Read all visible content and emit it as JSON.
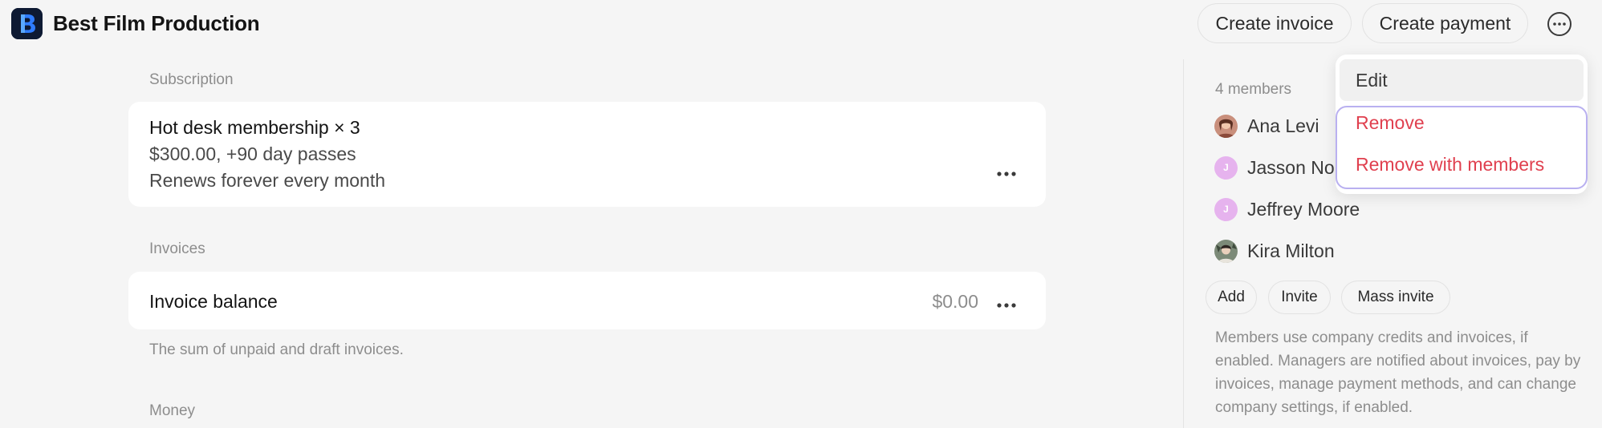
{
  "header": {
    "company_name": "Best Film Production",
    "logo_icon": "brand-b-logo",
    "create_invoice_label": "Create invoice",
    "create_payment_label": "Create payment",
    "more_icon": "more-circle-icon"
  },
  "subscription": {
    "section_label": "Subscription",
    "title": "Hot desk membership × 3",
    "price_line": "$300.00, +90 day passes",
    "renewal_line": "Renews forever every month"
  },
  "invoices": {
    "section_label": "Invoices",
    "balance_label": "Invoice balance",
    "balance_amount": "$0.00",
    "hint": "The sum of unpaid and draft invoices."
  },
  "money": {
    "section_label": "Money"
  },
  "members": {
    "count_label": "4 members",
    "list": [
      {
        "name": "Ana Levi",
        "avatar": "photo"
      },
      {
        "name": "Jasson No",
        "avatar": "initial",
        "initial": "J"
      },
      {
        "name": "Jeffrey Moore",
        "avatar": "initial",
        "initial": "J"
      },
      {
        "name": "Kira Milton",
        "avatar": "photo"
      }
    ],
    "add_label": "Add",
    "invite_label": "Invite",
    "mass_invite_label": "Mass invite",
    "description": "Members use company credits and invoices, if enabled. Managers are notified about invoices, pay by invoices, manage payment methods, and can change company settings, if enabled."
  },
  "dropdown": {
    "edit_label": "Edit",
    "remove_label": "Remove",
    "remove_with_members_label": "Remove with members"
  },
  "colors": {
    "background": "#f5f5f5",
    "danger": "#e0404f",
    "focus_ring": "#b9b0f0",
    "avatar_initial_bg": "#e6b3ee",
    "logo_bg": "#0e1a33"
  }
}
